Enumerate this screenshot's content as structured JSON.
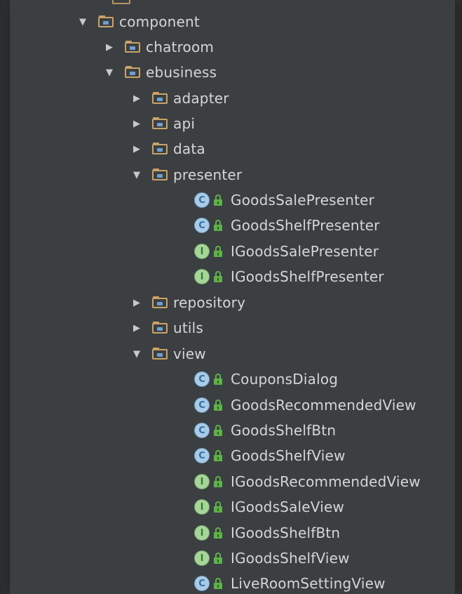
{
  "tree": {
    "root": {
      "label": "component",
      "expanded": true,
      "icon": "package-folder-icon",
      "children": [
        {
          "label": "chatroom",
          "expanded": false,
          "icon": "package-folder-icon"
        },
        {
          "label": "ebusiness",
          "expanded": true,
          "icon": "package-folder-icon",
          "children": [
            {
              "label": "adapter",
              "expanded": false,
              "icon": "package-folder-icon"
            },
            {
              "label": "api",
              "expanded": false,
              "icon": "package-folder-icon"
            },
            {
              "label": "data",
              "expanded": false,
              "icon": "package-folder-icon"
            },
            {
              "label": "presenter",
              "expanded": true,
              "icon": "package-folder-icon",
              "children": [
                {
                  "label": "GoodsSalePresenter",
                  "kind": "class",
                  "badge": "C"
                },
                {
                  "label": "GoodsShelfPresenter",
                  "kind": "class",
                  "badge": "C"
                },
                {
                  "label": "IGoodsSalePresenter",
                  "kind": "interface",
                  "badge": "I"
                },
                {
                  "label": "IGoodsShelfPresenter",
                  "kind": "interface",
                  "badge": "I"
                }
              ]
            },
            {
              "label": "repository",
              "expanded": false,
              "icon": "package-folder-icon"
            },
            {
              "label": "utils",
              "expanded": false,
              "icon": "package-folder-icon"
            },
            {
              "label": "view",
              "expanded": true,
              "icon": "package-folder-icon",
              "children": [
                {
                  "label": "CouponsDialog",
                  "kind": "class",
                  "badge": "C"
                },
                {
                  "label": "GoodsRecommendedView",
                  "kind": "class",
                  "badge": "C"
                },
                {
                  "label": "GoodsShelfBtn",
                  "kind": "class",
                  "badge": "C"
                },
                {
                  "label": "GoodsShelfView",
                  "kind": "class",
                  "badge": "C"
                },
                {
                  "label": "IGoodsRecommendedView",
                  "kind": "interface",
                  "badge": "I"
                },
                {
                  "label": "IGoodsSaleView",
                  "kind": "interface",
                  "badge": "I"
                },
                {
                  "label": "IGoodsShelfBtn",
                  "kind": "interface",
                  "badge": "I"
                },
                {
                  "label": "IGoodsShelfView",
                  "kind": "interface",
                  "badge": "I"
                },
                {
                  "label": "LiveRoomSettingView",
                  "kind": "class",
                  "badge": "C"
                }
              ]
            }
          ]
        }
      ]
    }
  },
  "colors": {
    "panel_bg": "#3c3f41",
    "text": "#d6d6d6",
    "folder": "#c9a466",
    "class_badge": "#a9cbe6",
    "interface_badge": "#a6d49a",
    "lock": "#5fb24a"
  },
  "glyphs": {
    "expanded_arrow": "▼",
    "collapsed_arrow": "▶"
  }
}
